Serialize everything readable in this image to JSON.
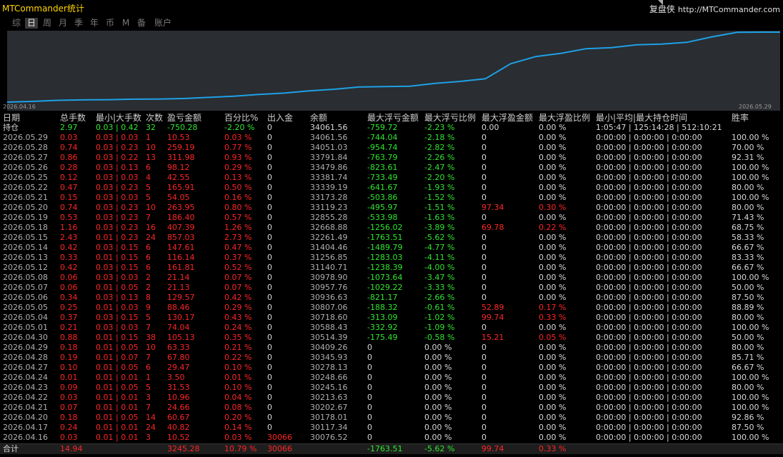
{
  "app": {
    "title": "MTCommander统计",
    "site_name": "复盘侠",
    "site_url": "http://MTCommander.com"
  },
  "tabs": [
    {
      "label": "综",
      "active": false
    },
    {
      "label": "日",
      "active": true
    },
    {
      "label": "周",
      "active": false
    },
    {
      "label": "月",
      "active": false
    },
    {
      "label": "季",
      "active": false
    },
    {
      "label": "年",
      "active": false
    },
    {
      "label": "币",
      "active": false
    },
    {
      "label": "M",
      "active": false
    },
    {
      "label": "备",
      "active": false
    },
    {
      "label": "账户",
      "active": false
    }
  ],
  "chart_data": {
    "type": "line",
    "x_start_label": "2026.04.16",
    "x_end_label": "2026.05.29",
    "line_color": "#1ea0e6",
    "dates": [
      "2026.04.16",
      "2026.04.17",
      "2026.04.20",
      "2026.04.21",
      "2026.04.22",
      "2026.04.23",
      "2026.04.24",
      "2026.04.27",
      "2026.04.28",
      "2026.04.29",
      "2026.04.30",
      "2026.05.01",
      "2026.05.04",
      "2026.05.05",
      "2026.05.06",
      "2026.05.07",
      "2026.05.08",
      "2026.05.12",
      "2026.05.13",
      "2026.05.14",
      "2026.05.15",
      "2026.05.18",
      "2026.05.19",
      "2026.05.20",
      "2026.05.21",
      "2026.05.22",
      "2026.05.25",
      "2026.05.26",
      "2026.05.27",
      "2026.05.28",
      "2026.05.29"
    ],
    "values": [
      30076.52,
      30117.34,
      30178.01,
      30202.67,
      30213.63,
      30245.16,
      30248.66,
      30278.13,
      30345.93,
      30409.26,
      30514.39,
      30588.43,
      30718.6,
      30807.06,
      30936.63,
      30957.76,
      30978.9,
      31140.71,
      31256.85,
      31404.46,
      32261.49,
      32668.88,
      32855.28,
      33119.23,
      33173.28,
      33339.19,
      33381.74,
      33479.86,
      33791.84,
      34051.03,
      34061.56
    ]
  },
  "table": {
    "headers": [
      "日期",
      "总手数",
      "最小|大手数",
      "次数",
      "盈亏金额",
      "百分比%",
      "出入金",
      "余额",
      "最大浮亏金额",
      "最大浮亏比例",
      "最大浮盈金额",
      "最大浮盈比例",
      "最小|平均|最大持仓时间",
      "胜率"
    ],
    "position_row": [
      "持仓",
      "2.97",
      "0.03 | 0.42",
      "32",
      "-750.28",
      "-2.20 %",
      "0",
      "34061.56",
      "-759.72",
      "-2.23 %",
      "0.00",
      "0.00 %",
      "1:05:47 | 125:14:28 | 512:10:21",
      ""
    ],
    "rows": [
      [
        "2026.05.29",
        "0.03",
        "0.03 | 0.03",
        "1",
        "10.53",
        "0.03 %",
        "0",
        "34061.56",
        "-744.04",
        "-2.18 %",
        "0",
        "0.00 %",
        "0:00:00 | 0:00:00 | 0:00:00",
        "100.00 %"
      ],
      [
        "2026.05.28",
        "0.74",
        "0.03 | 0.23",
        "10",
        "259.19",
        "0.77 %",
        "0",
        "34051.03",
        "-954.74",
        "-2.82 %",
        "0",
        "0.00 %",
        "0:00:00 | 0:00:00 | 0:00:00",
        "70.00 %"
      ],
      [
        "2026.05.27",
        "0.86",
        "0.03 | 0.22",
        "13",
        "311.98",
        "0.93 %",
        "0",
        "33791.84",
        "-763.79",
        "-2.26 %",
        "0",
        "0.00 %",
        "0:00:00 | 0:00:00 | 0:00:00",
        "92.31 %"
      ],
      [
        "2026.05.26",
        "0.28",
        "0.03 | 0.13",
        "6",
        "98.12",
        "0.29 %",
        "0",
        "33479.86",
        "-823.61",
        "-2.47 %",
        "0",
        "0.00 %",
        "0:00:00 | 0:00:00 | 0:00:00",
        "100.00 %"
      ],
      [
        "2026.05.25",
        "0.12",
        "0.03 | 0.03",
        "4",
        "42.55",
        "0.13 %",
        "0",
        "33381.74",
        "-733.49",
        "-2.20 %",
        "0",
        "0.00 %",
        "0:00:00 | 0:00:00 | 0:00:00",
        "100.00 %"
      ],
      [
        "2026.05.22",
        "0.47",
        "0.03 | 0.23",
        "5",
        "165.91",
        "0.50 %",
        "0",
        "33339.19",
        "-641.67",
        "-1.93 %",
        "0",
        "0.00 %",
        "0:00:00 | 0:00:00 | 0:00:00",
        "80.00 %"
      ],
      [
        "2026.05.21",
        "0.15",
        "0.03 | 0.03",
        "5",
        "54.05",
        "0.16 %",
        "0",
        "33173.28",
        "-503.86",
        "-1.52 %",
        "0",
        "0.00 %",
        "0:00:00 | 0:00:00 | 0:00:00",
        "100.00 %"
      ],
      [
        "2026.05.20",
        "0.74",
        "0.03 | 0.23",
        "10",
        "263.95",
        "0.80 %",
        "0",
        "33119.23",
        "-495.97",
        "-1.51 %",
        "97.34",
        "0.30 %",
        "0:00:00 | 0:00:00 | 0:00:00",
        "80.00 %"
      ],
      [
        "2026.05.19",
        "0.53",
        "0.03 | 0.23",
        "7",
        "186.40",
        "0.57 %",
        "0",
        "32855.28",
        "-533.98",
        "-1.63 %",
        "0",
        "0.00 %",
        "0:00:00 | 0:00:00 | 0:00:00",
        "71.43 %"
      ],
      [
        "2026.05.18",
        "1.16",
        "0.03 | 0.23",
        "16",
        "407.39",
        "1.26 %",
        "0",
        "32668.88",
        "-1256.02",
        "-3.89 %",
        "69.78",
        "0.22 %",
        "0:00:00 | 0:00:00 | 0:00:00",
        "68.75 %"
      ],
      [
        "2026.05.15",
        "2.43",
        "0.01 | 0.23",
        "24",
        "857.03",
        "2.73 %",
        "0",
        "32261.49",
        "-1763.51",
        "-5.62 %",
        "0",
        "0.00 %",
        "0:00:00 | 0:00:00 | 0:00:00",
        "58.33 %"
      ],
      [
        "2026.05.14",
        "0.42",
        "0.03 | 0.15",
        "6",
        "147.61",
        "0.47 %",
        "0",
        "31404.46",
        "-1489.79",
        "-4.77 %",
        "0",
        "0.00 %",
        "0:00:00 | 0:00:00 | 0:00:00",
        "66.67 %"
      ],
      [
        "2026.05.13",
        "0.33",
        "0.01 | 0.15",
        "6",
        "116.14",
        "0.37 %",
        "0",
        "31256.85",
        "-1283.03",
        "-4.11 %",
        "0",
        "0.00 %",
        "0:00:00 | 0:00:00 | 0:00:00",
        "83.33 %"
      ],
      [
        "2026.05.12",
        "0.42",
        "0.03 | 0.15",
        "6",
        "161.81",
        "0.52 %",
        "0",
        "31140.71",
        "-1238.39",
        "-4.00 %",
        "0",
        "0.00 %",
        "0:00:00 | 0:00:00 | 0:00:00",
        "66.67 %"
      ],
      [
        "2026.05.08",
        "0.06",
        "0.03 | 0.03",
        "2",
        "21.14",
        "0.07 %",
        "0",
        "30978.90",
        "-1073.64",
        "-3.47 %",
        "0",
        "0.00 %",
        "0:00:00 | 0:00:00 | 0:00:00",
        "100.00 %"
      ],
      [
        "2026.05.07",
        "0.06",
        "0.01 | 0.05",
        "2",
        "21.13",
        "0.07 %",
        "0",
        "30957.76",
        "-1029.22",
        "-3.33 %",
        "0",
        "0.00 %",
        "0:00:00 | 0:00:00 | 0:00:00",
        "50.00 %"
      ],
      [
        "2026.05.06",
        "0.34",
        "0.03 | 0.13",
        "8",
        "129.57",
        "0.42 %",
        "0",
        "30936.63",
        "-821.17",
        "-2.66 %",
        "0",
        "0.00 %",
        "0:00:00 | 0:00:00 | 0:00:00",
        "87.50 %"
      ],
      [
        "2026.05.05",
        "0.25",
        "0.01 | 0.03",
        "9",
        "88.46",
        "0.29 %",
        "0",
        "30807.06",
        "-188.32",
        "-0.61 %",
        "52.89",
        "0.17 %",
        "0:00:00 | 0:00:00 | 0:00:00",
        "88.89 %"
      ],
      [
        "2026.05.04",
        "0.37",
        "0.03 | 0.15",
        "5",
        "130.17",
        "0.43 %",
        "0",
        "30718.60",
        "-313.09",
        "-1.02 %",
        "99.74",
        "0.33 %",
        "0:00:00 | 0:00:00 | 0:00:00",
        "80.00 %"
      ],
      [
        "2026.05.01",
        "0.21",
        "0.03 | 0.03",
        "7",
        "74.04",
        "0.24 %",
        "0",
        "30588.43",
        "-332.92",
        "-1.09 %",
        "0",
        "0.00 %",
        "0:00:00 | 0:00:00 | 0:00:00",
        "100.00 %"
      ],
      [
        "2026.04.30",
        "0.88",
        "0.01 | 0.15",
        "38",
        "105.13",
        "0.35 %",
        "0",
        "30514.39",
        "-175.49",
        "-0.58 %",
        "15.21",
        "0.05 %",
        "0:00:00 | 0:00:00 | 0:00:00",
        "50.00 %"
      ],
      [
        "2026.04.29",
        "0.18",
        "0.01 | 0.05",
        "10",
        "63.33",
        "0.21 %",
        "0",
        "30409.26",
        "0",
        "0.00 %",
        "0",
        "0.00 %",
        "0:00:00 | 0:00:00 | 0:00:00",
        "80.00 %"
      ],
      [
        "2026.04.28",
        "0.19",
        "0.01 | 0.07",
        "7",
        "67.80",
        "0.22 %",
        "0",
        "30345.93",
        "0",
        "0.00 %",
        "0",
        "0.00 %",
        "0:00:00 | 0:00:00 | 0:00:00",
        "85.71 %"
      ],
      [
        "2026.04.27",
        "0.10",
        "0.01 | 0.05",
        "6",
        "29.47",
        "0.10 %",
        "0",
        "30278.13",
        "0",
        "0.00 %",
        "0",
        "0.00 %",
        "0:00:00 | 0:00:00 | 0:00:00",
        "66.67 %"
      ],
      [
        "2026.04.24",
        "0.01",
        "0.01 | 0.01",
        "1",
        "3.50",
        "0.01 %",
        "0",
        "30248.66",
        "0",
        "0.00 %",
        "0",
        "0.00 %",
        "0:00:00 | 0:00:00 | 0:00:00",
        "100.00 %"
      ],
      [
        "2026.04.23",
        "0.09",
        "0.01 | 0.05",
        "5",
        "31.53",
        "0.10 %",
        "0",
        "30245.16",
        "0",
        "0.00 %",
        "0",
        "0.00 %",
        "0:00:00 | 0:00:00 | 0:00:00",
        "80.00 %"
      ],
      [
        "2026.04.22",
        "0.03",
        "0.01 | 0.01",
        "3",
        "10.96",
        "0.04 %",
        "0",
        "30213.63",
        "0",
        "0.00 %",
        "0",
        "0.00 %",
        "0:00:00 | 0:00:00 | 0:00:00",
        "100.00 %"
      ],
      [
        "2026.04.21",
        "0.07",
        "0.01 | 0.01",
        "7",
        "24.66",
        "0.08 %",
        "0",
        "30202.67",
        "0",
        "0.00 %",
        "0",
        "0.00 %",
        "0:00:00 | 0:00:00 | 0:00:00",
        "100.00 %"
      ],
      [
        "2026.04.20",
        "0.18",
        "0.01 | 0.05",
        "14",
        "60.67",
        "0.20 %",
        "0",
        "30178.01",
        "0",
        "0.00 %",
        "0",
        "0.00 %",
        "0:00:00 | 0:00:00 | 0:00:00",
        "92.86 %"
      ],
      [
        "2026.04.17",
        "0.24",
        "0.01 | 0.01",
        "24",
        "40.82",
        "0.14 %",
        "0",
        "30117.34",
        "0",
        "0.00 %",
        "0",
        "0.00 %",
        "0:00:00 | 0:00:00 | 0:00:00",
        "87.50 %"
      ],
      [
        "2026.04.16",
        "0.03",
        "0.01 | 0.01",
        "3",
        "10.52",
        "0.03 %",
        "30066",
        "30076.52",
        "0",
        "0.00 %",
        "0",
        "0.00 %",
        "0:00:00 | 0:00:00 | 0:00:00",
        "100.00 %"
      ]
    ],
    "total_row": [
      "合计",
      "14.94",
      "",
      "",
      "3245.28",
      "10.79 %",
      "30066",
      "",
      "-1763.51",
      "-5.62 %",
      "99.74",
      "0.33 %",
      "",
      ""
    ]
  },
  "colors": {
    "positive": "#ff2525",
    "negative": "#2ee82e",
    "title": "#ffd700",
    "chart_bg": "#2a2d31"
  }
}
